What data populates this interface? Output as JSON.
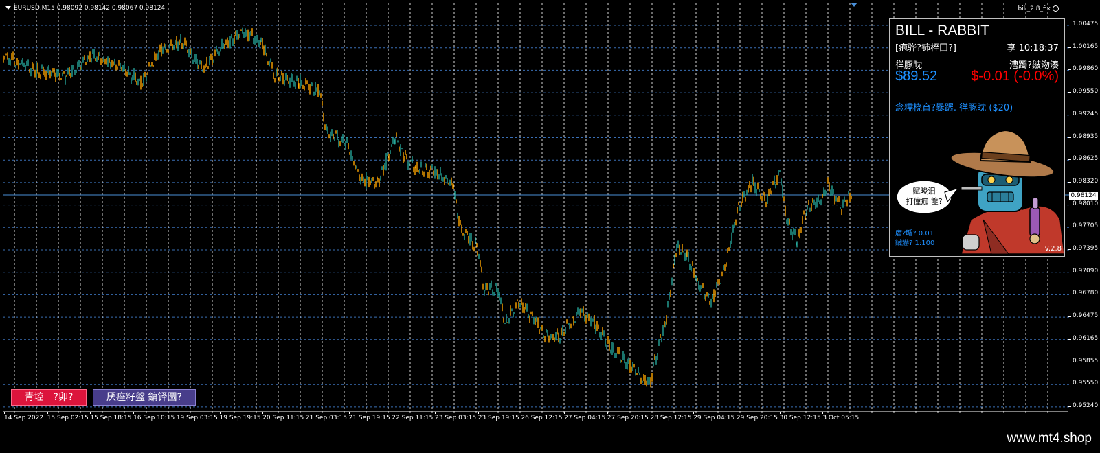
{
  "chart": {
    "symbol_line": "EURUSD,M15  0.98092 0.98142 0.98067 0.98124",
    "indicator_name": "bill_2.8_fix",
    "current_price": "0.98124",
    "price_levels": [
      "1.00475",
      "1.00165",
      "0.99860",
      "0.99550",
      "0.99245",
      "0.98935",
      "0.98625",
      "0.98320",
      "0.98010",
      "0.97705",
      "0.97395",
      "0.97090",
      "0.96780",
      "0.96475",
      "0.96165",
      "0.95855",
      "0.95550",
      "0.95240"
    ],
    "time_labels": [
      "14 Sep 2022",
      "15 Sep 02:15",
      "15 Sep 18:15",
      "16 Sep 10:15",
      "19 Sep 03:15",
      "19 Sep 19:15",
      "20 Sep 11:15",
      "21 Sep 03:15",
      "21 Sep 19:15",
      "22 Sep 11:15",
      "23 Sep 03:15",
      "23 Sep 19:15",
      "26 Sep 12:15",
      "27 Sep 04:15",
      "27 Sep 20:15",
      "28 Sep 12:15",
      "29 Sep 04:15",
      "29 Sep 20:15",
      "30 Sep 12:15",
      "3 Oct 05:15"
    ],
    "colors": {
      "up": "#26a69a",
      "down": "#ffa500",
      "grid_v": "#ffffff",
      "grid_h": "#3a6fb5",
      "price_line": "#4a90d9"
    }
  },
  "buttons": {
    "left_label": "青埪　?卯?",
    "right_label": "厌痤籽盤 鏞铎圖?"
  },
  "panel": {
    "title": "BILL - RABBIT",
    "subtitle": "[疱骅?铈桎囗?]",
    "time": "享 10:18:37",
    "balance_label": "徉豚眈",
    "balance_value": "$89.52",
    "pl_label": "漕躅?皴沕湊",
    "pl_value": "$-0.01 (-0.0%)",
    "note": "念糯桡窅?爨蹍. 徉豚眈 ($20)",
    "speech_line1": "賦晙汨",
    "speech_line2": "打僮痂 篚?",
    "spread": "庿?瞃? 0.01",
    "leverage": "鑶爀? 1:100",
    "version": "v.2.8"
  },
  "footer": {
    "url": "www.mt4.shop"
  }
}
